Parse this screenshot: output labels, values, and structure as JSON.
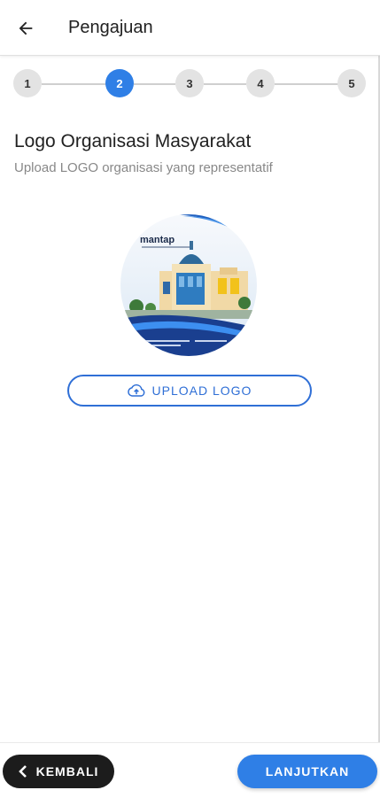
{
  "appbar": {
    "title": "Pengajuan",
    "back_icon": "arrow-left-icon"
  },
  "stepper": {
    "steps": [
      "1",
      "2",
      "3",
      "4",
      "5"
    ],
    "active_index": 1,
    "active_color": "#2f7fe6",
    "inactive_color": "#e3e3e3"
  },
  "section": {
    "title": "Logo Organisasi Masyarakat",
    "subtitle": "Upload LOGO organisasi yang representatif"
  },
  "logo_preview": {
    "brand_text": "mantap"
  },
  "upload": {
    "label": "UPLOAD LOGO",
    "icon": "cloud-upload-icon",
    "color": "#2f6fd6"
  },
  "footer": {
    "back_label": "KEMBALI",
    "back_icon": "chevron-left-icon",
    "next_label": "LANJUTKAN",
    "back_color": "#1c1c1c",
    "next_color": "#2f7fe6"
  }
}
